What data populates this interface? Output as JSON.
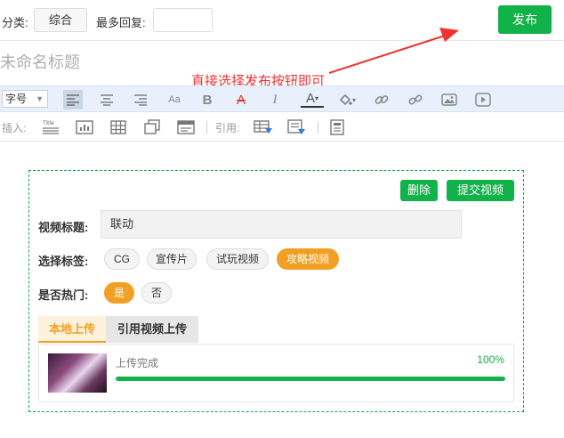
{
  "header": {
    "category_label": "分类:",
    "category_value": "综合",
    "max_reply_label": "最多回复:",
    "max_reply_value": "",
    "publish_label": "发布"
  },
  "editor": {
    "title_placeholder": "未命名标题",
    "annotation": "直接选择发布按钮即可",
    "font_size_label": "字号",
    "insert_label": "插入:",
    "quote_label": "引用:"
  },
  "video_block": {
    "delete_label": "删除",
    "submit_label": "提交视频",
    "title_label": "视频标题:",
    "title_value": "联动",
    "tags_label": "选择标签:",
    "tags": [
      "CG",
      "宣传片",
      "试玩视频",
      "攻略视频"
    ],
    "selected_tag": "攻略视频",
    "hot_label": "是否热门:",
    "hot_options": [
      "是",
      "否"
    ],
    "hot_selected": "是",
    "tabs": [
      "本地上传",
      "引用视频上传"
    ],
    "active_tab": "本地上传",
    "upload_status": "上传完成",
    "upload_percent_text": "100%",
    "upload_progress": 1.0
  },
  "colors": {
    "accent_green": "#12b24a",
    "accent_orange": "#f2a023",
    "annotation_red": "#e33"
  }
}
